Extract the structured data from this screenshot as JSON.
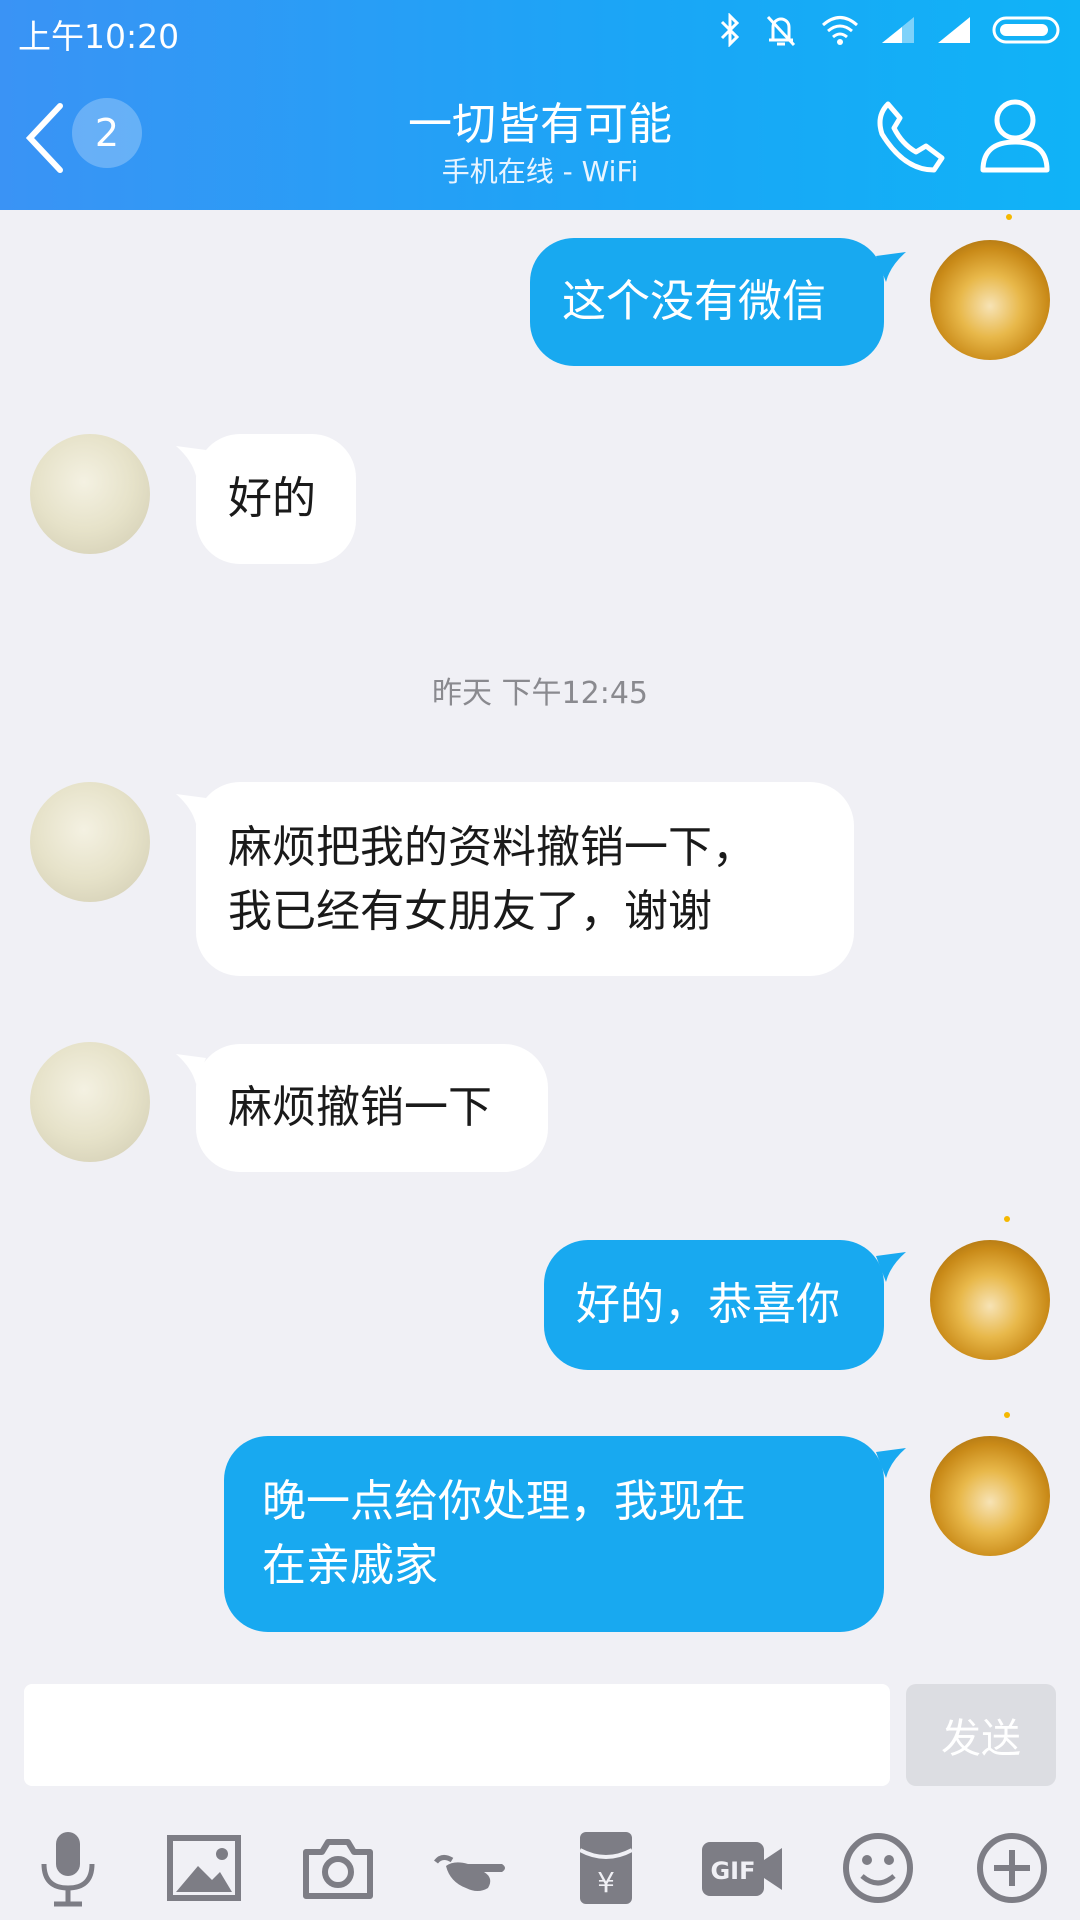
{
  "status_bar": {
    "time": "上午10:20"
  },
  "header": {
    "unread_count": "2",
    "title": "一切皆有可能",
    "subtitle": "手机在线 - WiFi"
  },
  "messages": [
    {
      "from": "me",
      "text": "这个没有微信"
    },
    {
      "from": "other",
      "text": "好的"
    },
    {
      "from": "other",
      "lines": [
        "麻烦把我的资料撤销一下，",
        "我已经有女朋友了，谢谢"
      ]
    },
    {
      "from": "other",
      "text": "麻烦撤销一下"
    },
    {
      "from": "me",
      "text": "好的，恭喜你"
    },
    {
      "from": "me",
      "lines": [
        "晚一点给你处理，我现在",
        "在亲戚家"
      ]
    }
  ],
  "timestamp": "昨天 下午12:45",
  "input": {
    "value": "",
    "send_label": "发送"
  },
  "toolbar_icons": [
    "microphone-icon",
    "image-icon",
    "camera-icon",
    "poke-icon",
    "red-packet-icon",
    "gif-icon",
    "emoji-icon",
    "plus-icon"
  ],
  "colors": {
    "header_start": "#3a93f5",
    "header_end": "#10b3f7",
    "bubble_me": "#18a9f0",
    "bubble_other": "#ffffff",
    "background": "#f0f0f5",
    "icon_gray": "#7d7d85"
  }
}
